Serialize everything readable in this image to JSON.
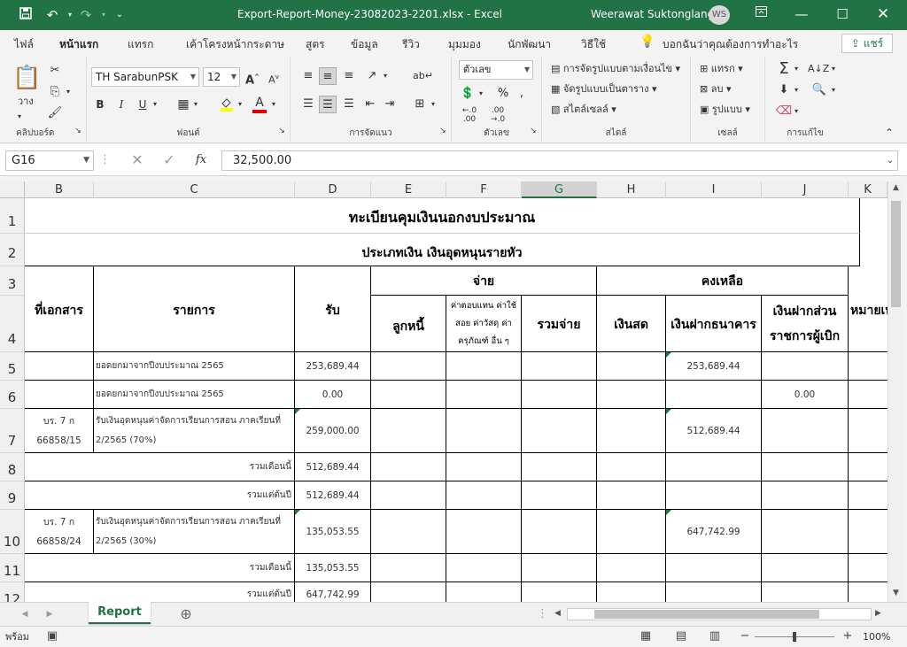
{
  "window": {
    "title": "Export-Report-Money-23082023-2201.xlsx  -  Excel",
    "user": "Weerawat Suktonglang",
    "user_initials": "WS"
  },
  "ribbon_tabs": [
    "ไฟล์",
    "หน้าแรก",
    "แทรก",
    "เค้าโครงหน้ากระดาษ",
    "สูตร",
    "ข้อมูล",
    "รีวิว",
    "มุมมอง",
    "นักพัฒนา",
    "วิธีใช้"
  ],
  "tell_me": "บอกฉันว่าคุณต้องการทำอะไร",
  "share_label": "แชร์",
  "ribbon": {
    "clipboard": {
      "paste": "วาง",
      "group": "คลิปบอร์ด"
    },
    "font": {
      "name": "TH SarabunPSK",
      "size": "12",
      "group": "ฟอนต์",
      "bold": "B",
      "italic": "I",
      "underline": "U"
    },
    "alignment": {
      "group": "การจัดแนว"
    },
    "number": {
      "format": "ตัวเลข",
      "group": "ตัวเลข"
    },
    "styles": {
      "cond_format": "การจัดรูปแบบตามเงื่อนไข",
      "format_table": "จัดรูปแบบเป็นตาราง",
      "cell_styles": "สไตล์เซลล์",
      "group": "สไตล์"
    },
    "cells": {
      "insert": "แทรก",
      "delete": "ลบ",
      "format": "รูปแบบ",
      "group": "เซลล์"
    },
    "editing": {
      "group": "การแก้ไข"
    }
  },
  "formula_bar": {
    "name_box": "G16",
    "formula": "32,500.00"
  },
  "columns": [
    {
      "label": "B"
    },
    {
      "label": "C"
    },
    {
      "label": "D"
    },
    {
      "label": "E"
    },
    {
      "label": "F"
    },
    {
      "label": "G"
    },
    {
      "label": "H"
    },
    {
      "label": "I"
    },
    {
      "label": "J"
    },
    {
      "label": "K"
    }
  ],
  "rows": [
    "1",
    "2",
    "3",
    "4",
    "5",
    "6",
    "7",
    "8",
    "9",
    "10",
    "11",
    "12"
  ],
  "sheet": {
    "title": "ทะเบียนคุมเงินนอกงบประมาณ",
    "subtitle": "ประเภทเงิน เงินอุดหนุนรายหัว",
    "h_doc": "ที่เอกสาร",
    "h_item": "รายการ",
    "h_receive": "รับ",
    "h_pay": "จ่าย",
    "h_balance": "คงเหลือ",
    "h_debtor": "ลูกหนี้",
    "h_comp": [
      "ค่าตอบแทน ค่าใช้",
      "สอย ค่าวัสดุ ค่า",
      "ครุภัณฑ์ อื่น ๆ"
    ],
    "h_total_pay": "รวมจ่าย",
    "h_cash": "เงินสด",
    "h_bank": "เงินฝากธนาคาร",
    "h_agency": [
      "เงินฝากส่วน",
      "ราชการผู้เบิก"
    ],
    "h_note": "หมายเหตุ",
    "r5": {
      "item": "ยอดยกมาจากปีงบประมาณ 2565",
      "receive": "253,689.44",
      "bank": "253,689.44"
    },
    "r6": {
      "item": "ยอดยกมาจากปีงบประมาณ 2565",
      "receive": "0.00",
      "agency": "0.00"
    },
    "r7": {
      "doc1": "บร. 7 ก",
      "doc2": "66858/15",
      "item1": "รับเงินอุดหนุนค่าจัดการเรียนการสอน ภาคเรียนที่",
      "item2": "2/2565 (70%)",
      "receive": "259,000.00",
      "bank": "512,689.44"
    },
    "r8": {
      "label": "รวมเดือนนี้",
      "receive": "512,689.44"
    },
    "r9": {
      "label": "รวมแต่ต้นปี",
      "receive": "512,689.44"
    },
    "r10": {
      "doc1": "บร. 7 ก",
      "doc2": "66858/24",
      "item1": "รับเงินอุดหนุนค่าจัดการเรียนการสอน ภาคเรียนที่",
      "item2": "2/2565 (30%)",
      "receive": "135,053.55",
      "bank": "647,742.99"
    },
    "r11": {
      "label": "รวมเดือนนี้",
      "receive": "135,053.55"
    },
    "r12": {
      "label": "รวมแต่ต้นปี",
      "receive": "647,742.99"
    }
  },
  "sheet_tabs": {
    "active": "Report"
  },
  "status": {
    "mode": "พร้อม",
    "zoom": "100%"
  }
}
